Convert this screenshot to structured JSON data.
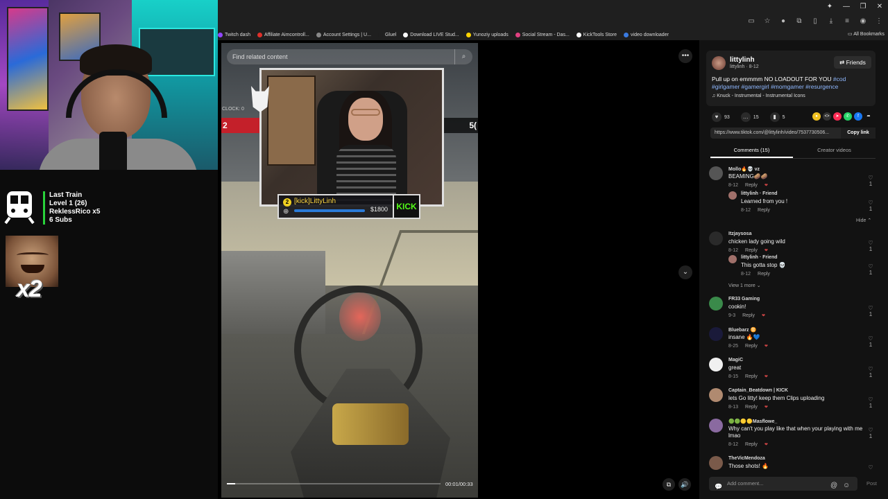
{
  "overlay": {
    "train_title": "Last Train",
    "train_level": "Level 1  (26)",
    "train_user": "ReklessRico x5",
    "train_subs": "6 Subs",
    "multiplier": "x2"
  },
  "bookmarks": {
    "items": [
      {
        "label": "Twitch dash",
        "color": "#9146ff"
      },
      {
        "label": "Affiliate Aimcontroll...",
        "color": "#e0302a"
      },
      {
        "label": "Account Settings | U...",
        "color": "#888888"
      },
      {
        "label": "Gluel",
        "color": "#1f1f1f"
      },
      {
        "label": "Download LIVE Stud...",
        "color": "#ffffff"
      },
      {
        "label": "Yunoziy uploads",
        "color": "#ffd400"
      },
      {
        "label": "Social Stream - Das...",
        "color": "#e04080"
      },
      {
        "label": "KickTools Store",
        "color": "#ffffff"
      },
      {
        "label": "video downloader",
        "color": "#3a7ae0"
      }
    ],
    "all_bookmarks": "All Bookmarks"
  },
  "video": {
    "search_placeholder": "Find related content",
    "streamer_tag": "[kick]LittyLinh",
    "level_badge": "2",
    "amount": "$1800",
    "kick_logo": "KICK",
    "clock_label": "CLOCK: 0",
    "hud_left_score": "2",
    "hud_right_score": "5(",
    "time": "00:01/00:33",
    "progress": 0.04
  },
  "post": {
    "author": "littylinh",
    "author_sub": "littylinh · 8-12",
    "friends_label": "Friends",
    "caption_text": "Pull up on emmmm NO LOADOUT FOR YOU ",
    "hashtags": [
      "#cod",
      "#girlgamer",
      "#gamergirl",
      "#momgamer",
      "#resurgence"
    ],
    "music": "Knuck - Instrumental - Instrumental Icons",
    "likes": "93",
    "comments_count": "15",
    "saves": "5",
    "url": "https://www.tiktok.com/@littylinh/video/7537730506...",
    "copy_link": "Copy link",
    "tab_comments": "Comments (15)",
    "tab_creator": "Creator videos",
    "comment_placeholder": "Add comment...",
    "post_label": "Post"
  },
  "comments": [
    {
      "user": "Mollo🔥💀 vz",
      "text": "BEAMING🥔🥔",
      "date": "8-12",
      "likes": "1",
      "avatar": "#555555"
    },
    {
      "user": "littylinh · Friend",
      "text": "Learned from you !",
      "date": "8-12",
      "likes": "1",
      "avatar": "#a0706a",
      "reply": true
    },
    {
      "user": "Itzjaysosa",
      "text": "chicken lady going wild",
      "date": "8-12",
      "likes": "1",
      "avatar": "#2a2a2a"
    },
    {
      "user": "littylinh · Friend",
      "text": "This gotta stop 💀",
      "date": "8-12",
      "likes": "1",
      "avatar": "#a0706a",
      "reply": true
    },
    {
      "user": "FR33 Gaming",
      "text": "cookin!",
      "date": "9-3",
      "likes": "1",
      "avatar": "#3a8a4a"
    },
    {
      "user": "Bluebarz ♊",
      "text": "insane 🔥💙",
      "date": "8-25",
      "likes": "1",
      "avatar": "#1a1a3a"
    },
    {
      "user": "MagiC",
      "text": "great",
      "date": "8-15",
      "likes": "1",
      "avatar": "#f0f0f0"
    },
    {
      "user": "Captain_Beatdown | KICK",
      "text": "lets Go litty! keep them Clips uploading",
      "date": "8-13",
      "likes": "1",
      "avatar": "#b08a70"
    },
    {
      "user": "🟢🟢🟡🟡Masflowe_",
      "text": "Why can't you play like that when your playing with me lmao",
      "date": "8-12",
      "likes": "1",
      "avatar": "#8a6aa0"
    },
    {
      "user": "TheVicMendoza",
      "text": "Those shots! 🔥",
      "date": "",
      "likes": "",
      "avatar": "#7a5a4a"
    }
  ],
  "comment_links": {
    "hide": "Hide",
    "view_more": "View 1 more",
    "reply": "Reply"
  }
}
